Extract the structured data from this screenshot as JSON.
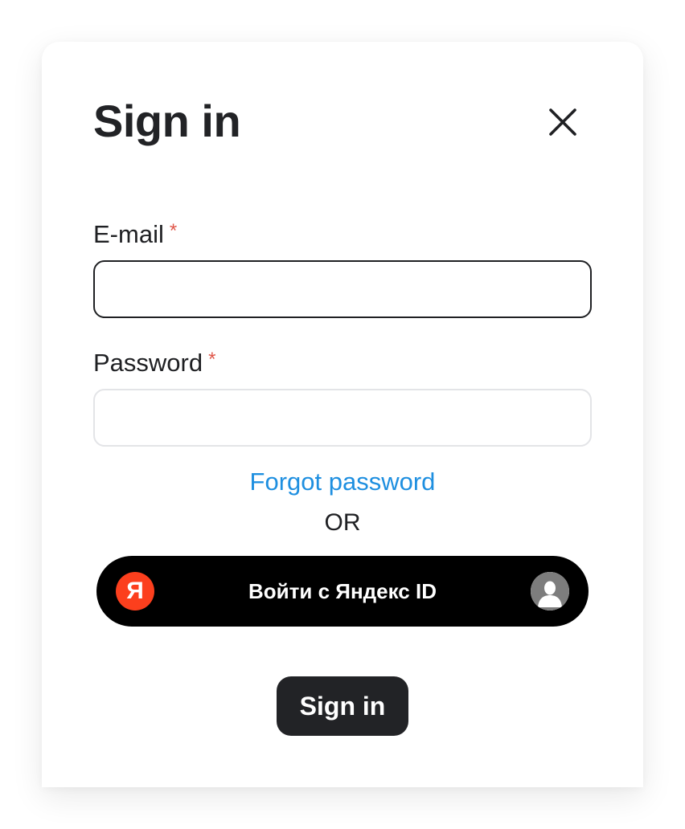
{
  "dialog": {
    "title": "Sign in",
    "close_icon": "close-icon"
  },
  "form": {
    "email": {
      "label": "E-mail",
      "required_marker": "*",
      "value": ""
    },
    "password": {
      "label": "Password",
      "required_marker": "*",
      "value": ""
    },
    "forgot_password_link": "Forgot password",
    "separator": "OR",
    "yandex_button": {
      "logo_letter": "Я",
      "label": "Войти с Яндекс ID",
      "logo_icon": "yandex-logo-icon",
      "avatar_icon": "user-avatar-icon",
      "color": "#000000",
      "logo_color": "#fc3f1d"
    },
    "submit_label": "Sign in"
  },
  "colors": {
    "accent_link": "#1e8fe0",
    "required": "#e0574a",
    "primary_button": "#222326"
  }
}
